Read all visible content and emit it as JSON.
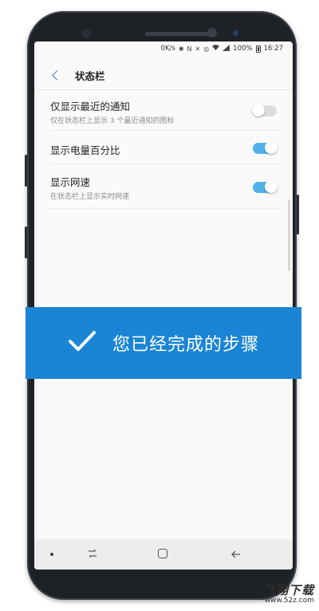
{
  "status_bar": {
    "network_speed": "0K/s",
    "battery_percent": "100%",
    "time": "16:27",
    "icons": [
      "bluetooth-icon",
      "nfc-icon",
      "mute-icon",
      "alarm-icon",
      "wifi-icon",
      "signal-icon",
      "battery-icon"
    ]
  },
  "header": {
    "back_icon": "back-arrow-icon",
    "title": "状态栏"
  },
  "settings": [
    {
      "title": "仅显示最近的通知",
      "subtitle": "仅在状态栏上显示 3 个最近通知的图标",
      "enabled": false
    },
    {
      "title": "显示电量百分比",
      "subtitle": "",
      "enabled": true
    },
    {
      "title": "显示网速",
      "subtitle": "在状态栏上显示实时网速",
      "enabled": true
    }
  ],
  "banner": {
    "icon": "checkmark-icon",
    "text": "您已经完成的步骤",
    "color": "#1a85d4"
  },
  "nav_bar": {
    "icons": [
      "dot-icon",
      "recent-apps-icon",
      "home-icon",
      "back-icon"
    ]
  },
  "watermark": {
    "logo": "飞翔下载",
    "url": "www.52z.com"
  },
  "colors": {
    "accent": "#4fb3e8",
    "back_arrow": "#3a7bd5"
  }
}
